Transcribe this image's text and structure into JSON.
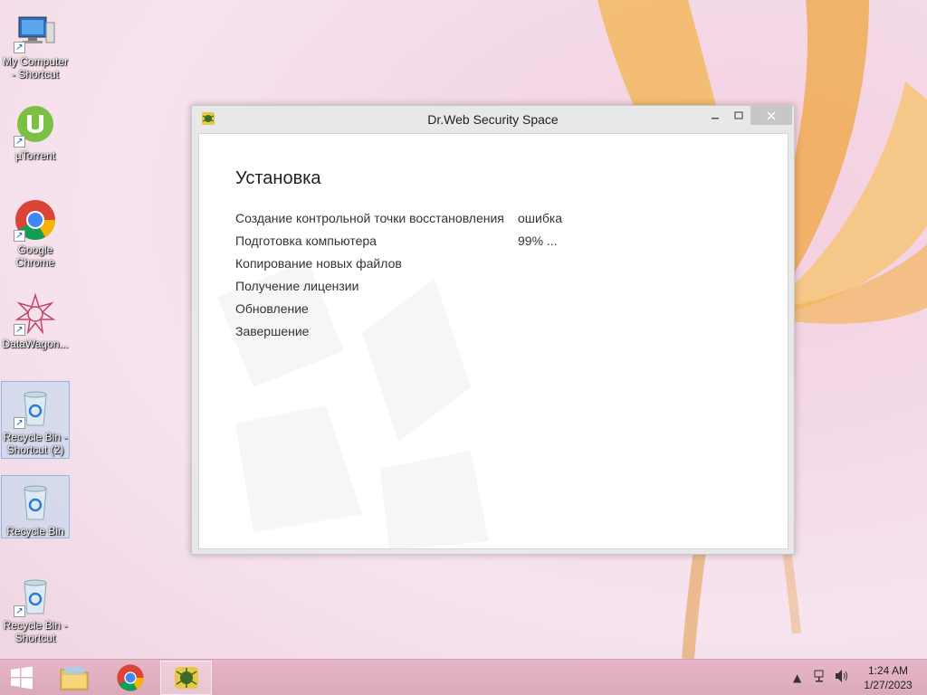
{
  "desktop": {
    "icons": [
      {
        "label": "My Computer\n- Shortcut",
        "icon": "computer-icon"
      },
      {
        "label": "µTorrent",
        "icon": "utorrent-icon"
      },
      {
        "label": "Google\nChrome",
        "icon": "chrome-icon"
      },
      {
        "label": "DataWagon...",
        "icon": "datawagon-icon"
      },
      {
        "label": "Recycle Bin -\nShortcut (2)",
        "icon": "recycle-bin-icon"
      },
      {
        "label": "Recycle Bin",
        "icon": "recycle-bin-icon"
      },
      {
        "label": "Recycle Bin -\nShortcut",
        "icon": "recycle-bin-icon"
      }
    ]
  },
  "window": {
    "title": "Dr.Web Security Space",
    "heading": "Установка",
    "steps": [
      {
        "name": "Создание контрольной точки восстановления",
        "status": "ошибка"
      },
      {
        "name": "Подготовка компьютера",
        "status": "99% ..."
      },
      {
        "name": "Копирование новых файлов",
        "status": ""
      },
      {
        "name": "Получение лицензии",
        "status": ""
      },
      {
        "name": "Обновление",
        "status": ""
      },
      {
        "name": "Завершение",
        "status": ""
      }
    ]
  },
  "taskbar": {
    "buttons": [
      "start-button",
      "file-explorer",
      "google-chrome",
      "dr-web"
    ],
    "clock": {
      "time": "1:24 AM",
      "date": "1/27/2023"
    }
  },
  "colors": {
    "taskbar": "#dba9bc",
    "window_frame": "#e8e8e8",
    "close_button": "#c7c7c7",
    "drweb_green": "#6aa63a"
  }
}
